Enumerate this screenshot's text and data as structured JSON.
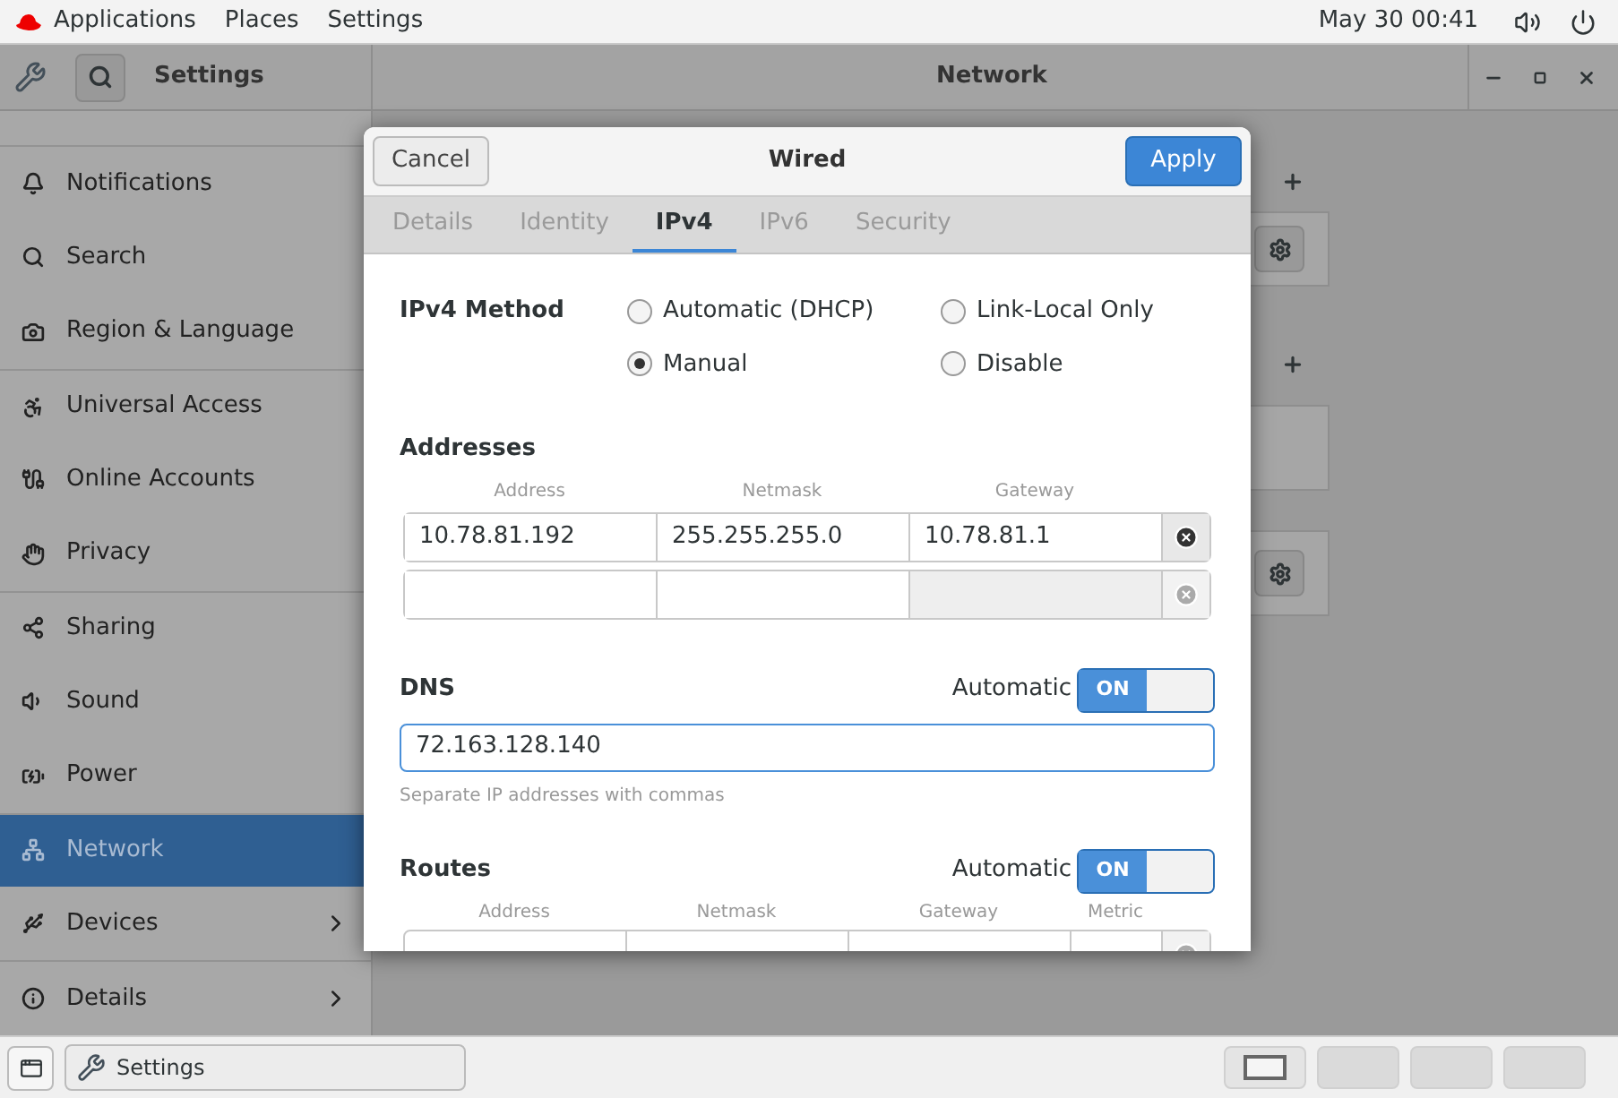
{
  "top_bar": {
    "menus": [
      "Applications",
      "Places",
      "Settings"
    ],
    "clock": "May 30 00:41"
  },
  "settings_window": {
    "sidebar_title": "Settings",
    "title": "Network"
  },
  "sidebar": {
    "items": [
      {
        "label": "Notifications",
        "selected": false,
        "submenu": false
      },
      {
        "label": "Search",
        "selected": false,
        "submenu": false
      },
      {
        "label": "Region & Language",
        "selected": false,
        "submenu": false
      },
      {
        "label": "Universal Access",
        "selected": false,
        "submenu": false
      },
      {
        "label": "Online Accounts",
        "selected": false,
        "submenu": false
      },
      {
        "label": "Privacy",
        "selected": false,
        "submenu": false
      },
      {
        "label": "Sharing",
        "selected": false,
        "submenu": false
      },
      {
        "label": "Sound",
        "selected": false,
        "submenu": false
      },
      {
        "label": "Power",
        "selected": false,
        "submenu": false
      },
      {
        "label": "Network",
        "selected": true,
        "submenu": false
      },
      {
        "label": "Devices",
        "selected": false,
        "submenu": true
      },
      {
        "label": "Details",
        "selected": false,
        "submenu": true
      }
    ]
  },
  "dialog": {
    "cancel": "Cancel",
    "title": "Wired",
    "apply": "Apply",
    "tabs": [
      {
        "label": "Details",
        "selected": false
      },
      {
        "label": "Identity",
        "selected": false
      },
      {
        "label": "IPv4",
        "selected": true
      },
      {
        "label": "IPv6",
        "selected": false
      },
      {
        "label": "Security",
        "selected": false
      }
    ],
    "ipv4_method": {
      "label": "IPv4 Method",
      "options": [
        {
          "label": "Automatic (DHCP)",
          "selected": false
        },
        {
          "label": "Link-Local Only",
          "selected": false
        },
        {
          "label": "Manual",
          "selected": true
        },
        {
          "label": "Disable",
          "selected": false
        }
      ]
    },
    "addresses": {
      "label": "Addresses",
      "columns": [
        "Address",
        "Netmask",
        "Gateway"
      ],
      "rows": [
        {
          "address": "10.78.81.192",
          "netmask": "255.255.255.0",
          "gateway": "10.78.81.1",
          "gateway_disabled": false,
          "removable": true
        },
        {
          "gateway_disabled": true,
          "removable": false
        }
      ]
    },
    "dns": {
      "label": "DNS",
      "automatic_label": "Automatic",
      "switch": {
        "on": true,
        "text": "ON"
      },
      "value": "72.163.128.140",
      "hint": "Separate IP addresses with commas"
    },
    "routes": {
      "label": "Routes",
      "automatic_label": "Automatic",
      "switch": {
        "on": true,
        "text": "ON"
      },
      "columns": [
        "Address",
        "Netmask",
        "Gateway",
        "Metric"
      ]
    }
  },
  "taskbar": {
    "app": "Settings",
    "workspaces": [
      {
        "selected": true
      },
      {
        "selected": false
      },
      {
        "selected": false
      },
      {
        "selected": false
      }
    ]
  }
}
